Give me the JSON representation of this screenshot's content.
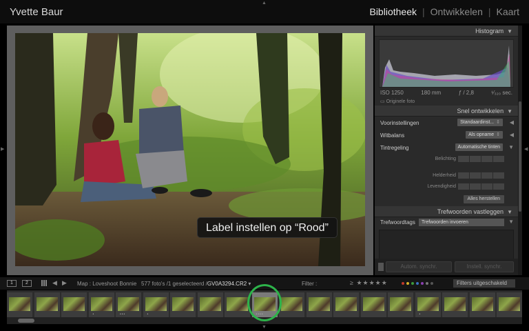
{
  "app": {
    "user_name": "Yvette Baur",
    "modules": [
      "Bibliotheek",
      "Ontwikkelen",
      "Kaart"
    ],
    "module_separator": "|",
    "active_module": "Bibliotheek"
  },
  "overlay": {
    "label": "Label instellen op “Rood”"
  },
  "panels": {
    "histogram": {
      "title": "Histogram",
      "iso": "ISO 1250",
      "focal": "180 mm",
      "aperture": "ƒ / 2,8",
      "shutter": "¹⁄₃₂₀ sec.",
      "original_label": "Originele foto"
    },
    "quick_develop": {
      "title": "Snel ontwikkelen",
      "presets_label": "Voorinstellingen",
      "presets_value": "Standaardinst...",
      "wb_label": "Witbalans",
      "wb_value": "Als opname",
      "tone_label": "Tintregeling",
      "tone_value": "Automatische tinten",
      "exposure_label": "Belichting",
      "clarity_label": "Helderheid",
      "vibrance_label": "Levendigheid",
      "reset_label": "Alles herstellen"
    },
    "keywording": {
      "title": "Trefwoorden vastleggen",
      "tags_label": "Trefwoordtags",
      "tags_value": "Trefwoorden invoeren"
    },
    "sync": {
      "auto_label": "Autom. synchr.",
      "settings_label": "Instell. synchr."
    }
  },
  "filmstrip_toolbar": {
    "screen1": "1",
    "screen2": "2",
    "breadcrumb": "Map : Loveshoot Bonnie",
    "count_prefix": "577 foto's /1 geselecteerd /",
    "filename": "GV0A3294.CR2",
    "filename_arrow": "▾",
    "filter_label": "Filter :",
    "rating_op": "≥",
    "stars": "★★★★★",
    "filters_off": "Filters uitgeschakeld",
    "label_colors": [
      "#c0392b",
      "#d6b12a",
      "#3c9a3c",
      "#3a6fc2",
      "#8a3fb0",
      "#777777",
      "#555555"
    ]
  },
  "icons": {
    "panel_collapse": "triangle-down-icon",
    "panel_expand": "triangle-left-icon",
    "grid_view": "grid-icon",
    "nav_prev": "arrow-left-icon",
    "nav_next": "arrow-right-icon"
  }
}
